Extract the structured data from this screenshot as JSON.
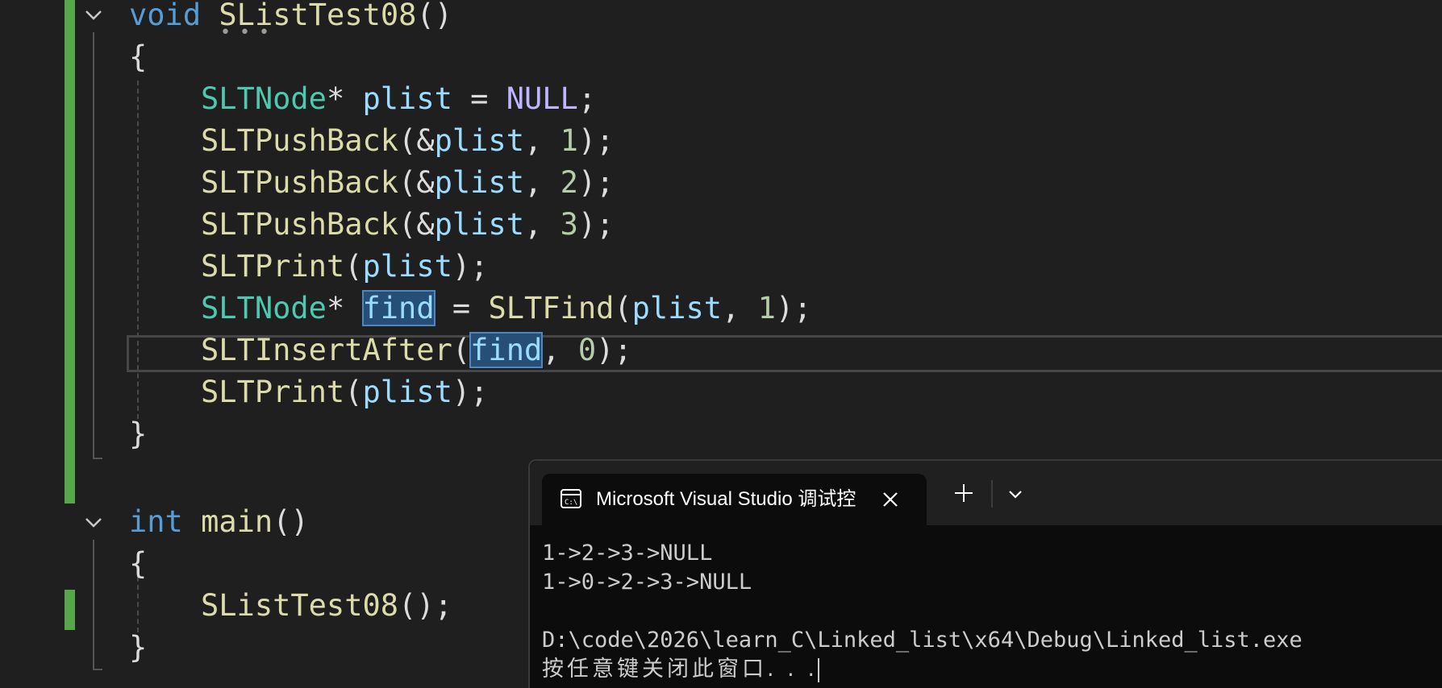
{
  "editor": {
    "lines": [
      {
        "tokens": [
          {
            "t": "void",
            "c": "kw"
          },
          {
            "t": " ",
            "c": "punc"
          },
          {
            "t": "SListTest08",
            "c": "fn"
          },
          {
            "t": "()",
            "c": "punc"
          }
        ]
      },
      {
        "tokens": [
          {
            "t": "{",
            "c": "punc"
          }
        ]
      },
      {
        "tokens": [
          {
            "t": "SLTNode",
            "c": "ty"
          },
          {
            "t": "* ",
            "c": "punc"
          },
          {
            "t": "plist",
            "c": "var"
          },
          {
            "t": " = ",
            "c": "punc"
          },
          {
            "t": "NULL",
            "c": "macro"
          },
          {
            "t": ";",
            "c": "punc"
          }
        ]
      },
      {
        "tokens": [
          {
            "t": "SLTPushBack",
            "c": "fn"
          },
          {
            "t": "(&",
            "c": "punc"
          },
          {
            "t": "plist",
            "c": "var"
          },
          {
            "t": ", ",
            "c": "punc"
          },
          {
            "t": "1",
            "c": "num"
          },
          {
            "t": ");",
            "c": "punc"
          }
        ]
      },
      {
        "tokens": [
          {
            "t": "SLTPushBack",
            "c": "fn"
          },
          {
            "t": "(&",
            "c": "punc"
          },
          {
            "t": "plist",
            "c": "var"
          },
          {
            "t": ", ",
            "c": "punc"
          },
          {
            "t": "2",
            "c": "num"
          },
          {
            "t": ");",
            "c": "punc"
          }
        ]
      },
      {
        "tokens": [
          {
            "t": "SLTPushBack",
            "c": "fn"
          },
          {
            "t": "(&",
            "c": "punc"
          },
          {
            "t": "plist",
            "c": "var"
          },
          {
            "t": ", ",
            "c": "punc"
          },
          {
            "t": "3",
            "c": "num"
          },
          {
            "t": ");",
            "c": "punc"
          }
        ]
      },
      {
        "tokens": [
          {
            "t": "SLTPrint",
            "c": "fn"
          },
          {
            "t": "(",
            "c": "punc"
          },
          {
            "t": "plist",
            "c": "var"
          },
          {
            "t": ");",
            "c": "punc"
          }
        ]
      },
      {
        "tokens": [
          {
            "t": "SLTNode",
            "c": "ty"
          },
          {
            "t": "* ",
            "c": "punc"
          },
          {
            "t": "find",
            "c": "var hl"
          },
          {
            "t": " = ",
            "c": "punc"
          },
          {
            "t": "SLTFind",
            "c": "fn"
          },
          {
            "t": "(",
            "c": "punc"
          },
          {
            "t": "plist",
            "c": "var"
          },
          {
            "t": ", ",
            "c": "punc"
          },
          {
            "t": "1",
            "c": "num"
          },
          {
            "t": ");",
            "c": "punc"
          }
        ]
      },
      {
        "tokens": [
          {
            "t": "SLTInsertAfter",
            "c": "fn"
          },
          {
            "t": "(",
            "c": "punc"
          },
          {
            "t": "find",
            "c": "var hl"
          },
          {
            "t": ", ",
            "c": "punc"
          },
          {
            "t": "0",
            "c": "num"
          },
          {
            "t": ");",
            "c": "punc"
          }
        ]
      },
      {
        "tokens": [
          {
            "t": "SLTPrint",
            "c": "fn"
          },
          {
            "t": "(",
            "c": "punc"
          },
          {
            "t": "plist",
            "c": "var"
          },
          {
            "t": ");",
            "c": "punc"
          }
        ]
      },
      {
        "tokens": [
          {
            "t": "}",
            "c": "punc"
          }
        ]
      },
      {
        "tokens": []
      },
      {
        "tokens": [
          {
            "t": "int",
            "c": "kw"
          },
          {
            "t": " ",
            "c": "punc"
          },
          {
            "t": "main",
            "c": "fn"
          },
          {
            "t": "()",
            "c": "punc"
          }
        ]
      },
      {
        "tokens": [
          {
            "t": "{",
            "c": "punc"
          }
        ]
      },
      {
        "tokens": [
          {
            "t": "SListTest08",
            "c": "fn"
          },
          {
            "t": "();",
            "c": "punc"
          }
        ]
      },
      {
        "tokens": [
          {
            "t": "}",
            "c": "punc"
          }
        ]
      }
    ],
    "squiggle": "• • •"
  },
  "console": {
    "tab_title": "Microsoft Visual Studio 调试控",
    "icons": {
      "tab": "console-icon",
      "close": "close-icon",
      "new_tab": "plus-icon",
      "dropdown": "chevron-down-icon"
    },
    "lines": [
      "1->2->3->NULL",
      "1->0->2->3->NULL",
      "",
      "D:\\code\\2026\\learn_C\\Linked_list\\x64\\Debug\\Linked_list.exe"
    ],
    "prompt": "按任意键关闭此窗口. . ."
  },
  "colors": {
    "editor_bg": "#1f1f1f",
    "change_bar": "#57a64a",
    "keyword": "#569cd6",
    "function": "#dcdcaa",
    "type": "#4ec9b0",
    "variable": "#9cdcfe",
    "number": "#b5cea8",
    "macro": "#beb7ff",
    "console_bg": "#0c0c0c"
  }
}
